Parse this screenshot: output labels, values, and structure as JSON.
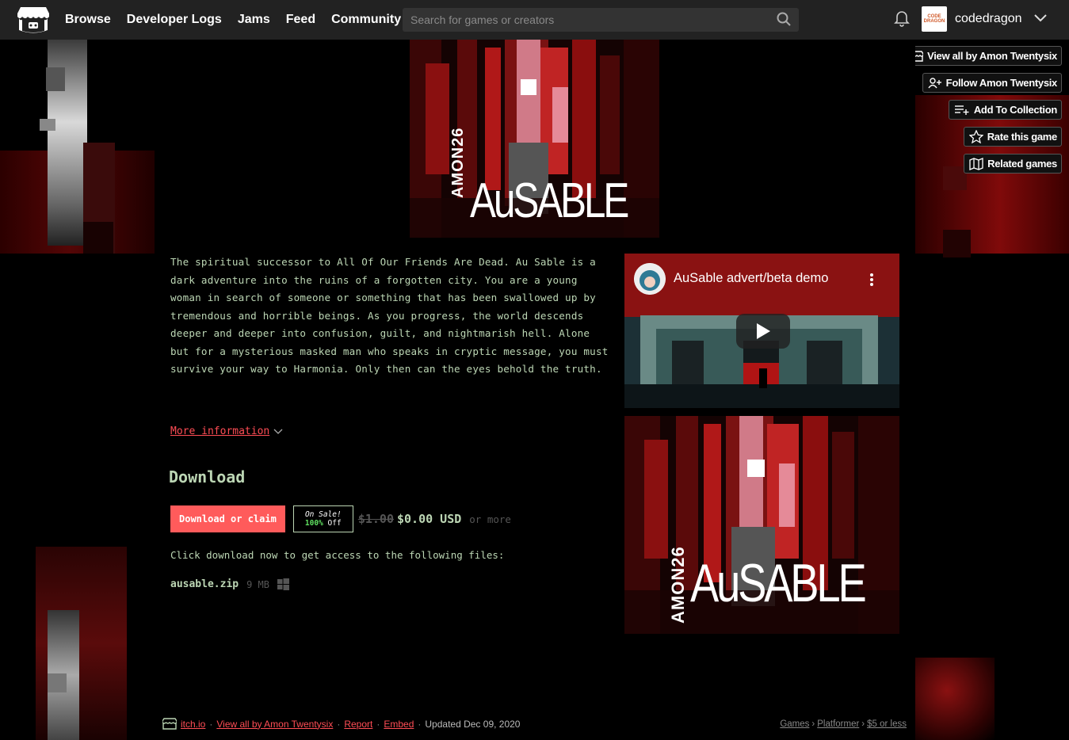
{
  "nav": {
    "items": [
      "Browse",
      "Developer Logs",
      "Jams",
      "Feed",
      "Community"
    ],
    "search_placeholder": "Search for games or creators",
    "username": "codedragon",
    "avatar_text": "CODE DRAGON"
  },
  "side_buttons": [
    {
      "label": "View all by Amon Twentysix",
      "icon": "itchio-icon"
    },
    {
      "label": "Follow Amon Twentysix",
      "icon": "user-plus-icon"
    },
    {
      "label": "Add To Collection",
      "icon": "list-plus-icon"
    },
    {
      "label": "Rate this game",
      "icon": "star-icon"
    },
    {
      "label": "Related games",
      "icon": "map-icon"
    }
  ],
  "cover": {
    "brand": "AMON26",
    "title": "AuSABLE"
  },
  "description": "The spiritual successor to All Of Our Friends Are Dead. Au Sable is a dark adventure into the ruins of a forgotten city. You are a young woman in search of someone or something that has been swallowed up by tremendous and horrible beings. As you progress, the world descends deeper and deeper into confusion, guilt, and nightmarish hell. Alone but for a mysterious masked man who speaks in cryptic message, you must survive your way to Harmonia. Only then can the eyes behold the truth.",
  "more_info": "More information",
  "download": {
    "title": "Download",
    "button": "Download or claim",
    "sale_line1": "On Sale!",
    "sale_pct": "100%",
    "sale_off": "Off",
    "old_price": "$1.00",
    "price": "$0.00 USD",
    "or_more": "or more",
    "files_note": "Click download now to get access to the following files:",
    "file_name": "ausable.zip",
    "file_size": "9 MB",
    "platform_icon": "windows-icon"
  },
  "video": {
    "title": "AuSable advert/beta demo"
  },
  "footer": {
    "itchio": "itch.io",
    "view_all": "View all by Amon Twentysix",
    "report": "Report",
    "embed": "Embed",
    "updated": "Updated Dec 09, 2020"
  },
  "breadcrumbs": [
    "Games",
    "Platformer",
    "$5 or less"
  ],
  "colors": {
    "accent": "#ff4d55",
    "text": "#bcd6b4",
    "button": "#ff5b5b",
    "sale_green": "#5fe060",
    "topbar": "#222222"
  }
}
